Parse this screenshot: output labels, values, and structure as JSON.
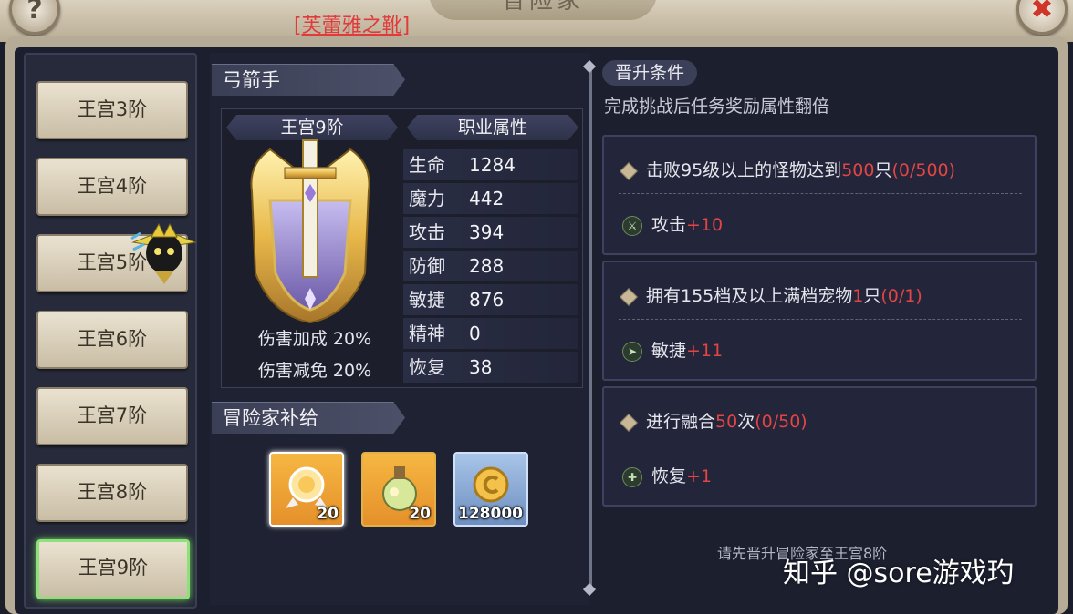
{
  "top": {
    "title": "冒险家",
    "caption": "[芙蕾雅之靴]",
    "help_icon": "question-icon",
    "close_icon": "close-icon"
  },
  "tabs": [
    "王宫3阶",
    "王宫4阶",
    "王宫5阶",
    "王宫6阶",
    "王宫7阶",
    "王宫8阶",
    "王宫9阶"
  ],
  "active_tab": "王宫9阶",
  "class_panel": {
    "class_name": "弓箭手",
    "rank_label": "王宫9阶",
    "attr_header": "职业属性",
    "bonuses": [
      "伤害加成 20%",
      "伤害减免 20%"
    ],
    "stats": [
      {
        "name": "生命",
        "value": "1284"
      },
      {
        "name": "魔力",
        "value": "442"
      },
      {
        "name": "攻击",
        "value": "394"
      },
      {
        "name": "防御",
        "value": "288"
      },
      {
        "name": "敏捷",
        "value": "876"
      },
      {
        "name": "精神",
        "value": "0"
      },
      {
        "name": "恢复",
        "value": "38"
      }
    ]
  },
  "supply": {
    "title": "冒险家补给",
    "items": [
      {
        "icon": "badge-icon",
        "count": "20"
      },
      {
        "icon": "potion-icon",
        "count": "20"
      },
      {
        "icon": "coin-icon",
        "count": "128000"
      }
    ]
  },
  "requirements": {
    "label": "晋升条件",
    "subtitle": "完成挑战后任务奖励属性翻倍",
    "tasks": [
      {
        "pre": "击败95级以上的怪物达到",
        "num": "500",
        "mid": "只",
        "progress": "(0/500)",
        "reward_attr": "攻击",
        "reward_val": "+10"
      },
      {
        "pre": "拥有155档及以上满档宠物",
        "num": "1",
        "mid": "只",
        "progress": "(0/1)",
        "reward_attr": "敏捷",
        "reward_val": "+11"
      },
      {
        "pre": "进行融合",
        "num": "50",
        "mid": "次",
        "progress": "(0/50)",
        "reward_attr": "恢复",
        "reward_val": "+1"
      }
    ],
    "note": "请先晋升冒险家至王宫8阶"
  },
  "watermark": "知乎 @sore游戏玓",
  "colors": {
    "accent_red": "#e34444",
    "active_tab_border": "#8ee07a",
    "gold": "#e2b04a"
  }
}
